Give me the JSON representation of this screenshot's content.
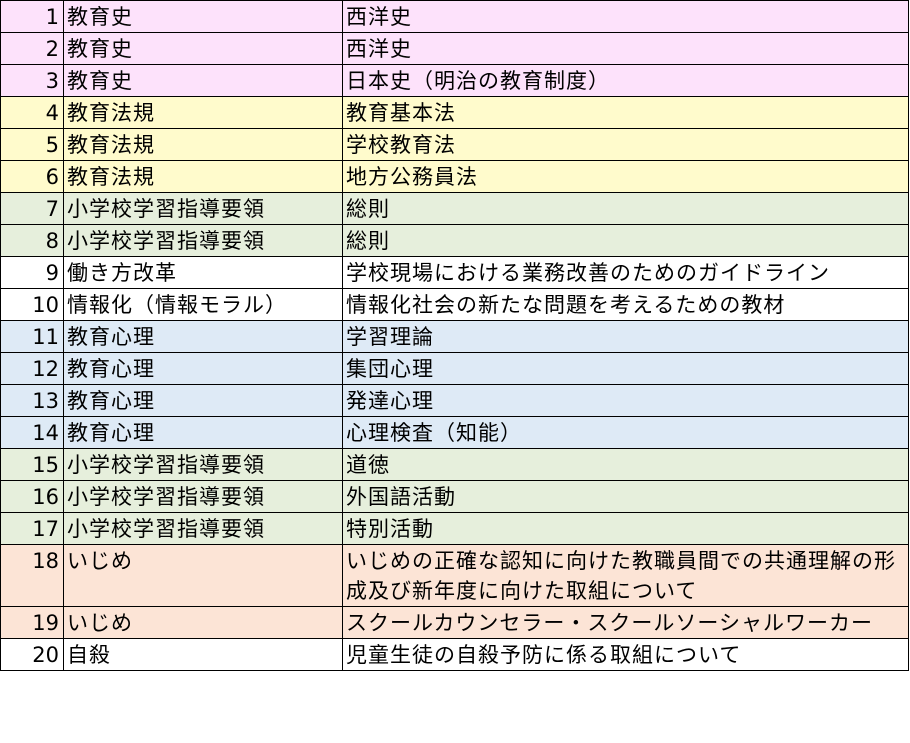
{
  "colors": {
    "教育史": "#fde2fb",
    "教育法規": "#fffbcc",
    "小学校学習指導要領": "#e6efdc",
    "教育心理": "#deeaf6",
    "いじめ": "#fce4d6",
    "default": "#ffffff"
  },
  "rows": [
    {
      "num": "1",
      "category": "教育史",
      "topic": "西洋史"
    },
    {
      "num": "2",
      "category": "教育史",
      "topic": "西洋史"
    },
    {
      "num": "3",
      "category": "教育史",
      "topic": "日本史（明治の教育制度）"
    },
    {
      "num": "4",
      "category": "教育法規",
      "topic": "教育基本法"
    },
    {
      "num": "5",
      "category": "教育法規",
      "topic": "学校教育法"
    },
    {
      "num": "6",
      "category": "教育法規",
      "topic": "地方公務員法"
    },
    {
      "num": "7",
      "category": "小学校学習指導要領",
      "topic": "総則"
    },
    {
      "num": "8",
      "category": "小学校学習指導要領",
      "topic": "総則"
    },
    {
      "num": "9",
      "category": "働き方改革",
      "topic": "学校現場における業務改善のためのガイドライン"
    },
    {
      "num": "10",
      "category": "情報化（情報モラル）",
      "topic": "情報化社会の新たな問題を考えるための教材"
    },
    {
      "num": "11",
      "category": "教育心理",
      "topic": "学習理論"
    },
    {
      "num": "12",
      "category": "教育心理",
      "topic": "集団心理"
    },
    {
      "num": "13",
      "category": "教育心理",
      "topic": "発達心理"
    },
    {
      "num": "14",
      "category": "教育心理",
      "topic": "心理検査（知能）"
    },
    {
      "num": "15",
      "category": "小学校学習指導要領",
      "topic": "道徳"
    },
    {
      "num": "16",
      "category": "小学校学習指導要領",
      "topic": "外国語活動"
    },
    {
      "num": "17",
      "category": "小学校学習指導要領",
      "topic": "特別活動"
    },
    {
      "num": "18",
      "category": "いじめ",
      "topic": "いじめの正確な認知に向けた教職員間での共通理解の形成及び新年度に向けた取組について"
    },
    {
      "num": "19",
      "category": "いじめ",
      "topic": "スクールカウンセラー・スクールソーシャルワーカー"
    },
    {
      "num": "20",
      "category": "自殺",
      "topic": "児童生徒の自殺予防に係る取組について"
    }
  ]
}
